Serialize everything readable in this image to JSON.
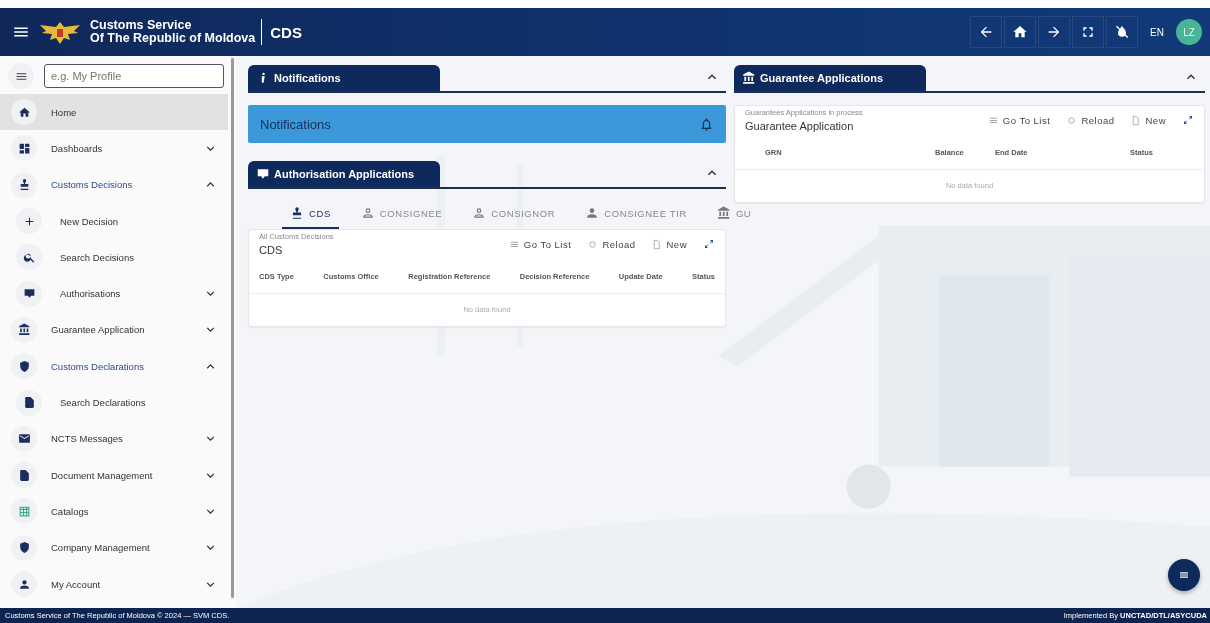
{
  "header": {
    "org_line1": "Customs Service",
    "org_line2": "Of The Republic of Moldova",
    "app": "CDS",
    "language": "EN",
    "avatar": "LZ"
  },
  "sidebar": {
    "search": {
      "placeholder": "e.g. My Profile"
    },
    "items": [
      {
        "label": "Home",
        "selected": true
      },
      {
        "label": "Dashboards",
        "selected": false,
        "expanded": false
      },
      {
        "label": "Customs Decisions",
        "selected": false,
        "expanded": true,
        "children": [
          {
            "label": "New Decision",
            "selected": false
          },
          {
            "label": "Search Decisions",
            "selected": false
          },
          {
            "label": "Authorisations",
            "selected": false,
            "expanded": false
          }
        ]
      },
      {
        "label": "Guarantee Application",
        "selected": false,
        "expanded": false
      },
      {
        "label": "Customs Declarations",
        "selected": false,
        "expanded": true,
        "children": [
          {
            "label": "Search Declarations",
            "selected": false
          }
        ]
      },
      {
        "label": "NCTS Messages",
        "selected": false,
        "expanded": false
      },
      {
        "label": "Document Management",
        "selected": false,
        "expanded": false
      },
      {
        "label": "Catalogs",
        "selected": false,
        "expanded": false
      },
      {
        "label": "Company Management",
        "selected": false,
        "expanded": false
      },
      {
        "label": "My Account",
        "selected": false,
        "expanded": false
      }
    ]
  },
  "notifications": {
    "title": "Notifications",
    "expanded": true,
    "banner": "Notifications"
  },
  "authorisations": {
    "title": "Authorisation Applications",
    "expanded": true,
    "tabs": [
      {
        "label": "CDS",
        "selected": true
      },
      {
        "label": "CONSIGNEE",
        "selected": false
      },
      {
        "label": "CONSIGNOR",
        "selected": false
      },
      {
        "label": "CONSIGNEE TIR",
        "selected": false
      },
      {
        "label": "GU",
        "selected": false
      }
    ],
    "card": {
      "caption": "All Customs Decisions",
      "title": "CDS",
      "actions": [
        "Go To List",
        "Reload",
        "New"
      ],
      "columns": [
        "CDS Type",
        "Customs Office",
        "Registration Reference",
        "Decision Reference",
        "Update Date",
        "Status"
      ],
      "empty": "No data found"
    }
  },
  "guarantees": {
    "title": "Guarantee Applications",
    "expanded": true,
    "card": {
      "caption": "Guarantees Applications in process",
      "title": "Guarantee Application",
      "actions": [
        "Go To List",
        "Reload",
        "New"
      ],
      "columns": [
        "GRN",
        "Balance",
        "End Date",
        "Status"
      ],
      "empty": "No data found"
    }
  },
  "footer": {
    "left": "Customs Service of The Republic of Moldova © 2024 — SVM CDS.",
    "right": "Implemented By **UNCTAD/DTL/ASYCUDA**"
  }
}
